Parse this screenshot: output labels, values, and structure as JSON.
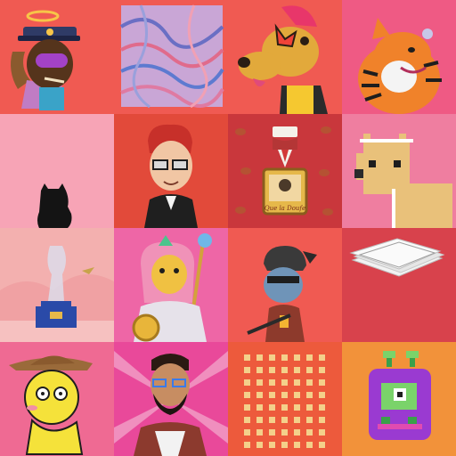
{
  "gallery": {
    "tiles": [
      {
        "id": "nft-1",
        "subject": "haloed-police-cat-avatar",
        "background": "#f05a52"
      },
      {
        "id": "nft-2",
        "subject": "abstract-swirl-art",
        "background": "#f05a52"
      },
      {
        "id": "nft-3",
        "subject": "dog-with-red-hair-avatar",
        "background": "#f05a52"
      },
      {
        "id": "nft-4",
        "subject": "tiger-cartoon-avatar",
        "background": "#ef5a84"
      },
      {
        "id": "nft-5",
        "subject": "cat-silhouette-art",
        "background": "#f7a4b6"
      },
      {
        "id": "nft-6",
        "subject": "red-haired-man-avatar",
        "background": "#e24a3a"
      },
      {
        "id": "nft-7",
        "subject": "medal-collectible",
        "background": "#c9373c",
        "medal_caption": "Que la Doufe"
      },
      {
        "id": "nft-8",
        "subject": "pixel-alpaca-avatar",
        "background": "#ef7ea0"
      },
      {
        "id": "nft-9",
        "subject": "crystal-statue-3d-art",
        "background": "#f0a1a3"
      },
      {
        "id": "nft-10",
        "subject": "pink-haired-fantasy-warrior",
        "background": "#ee66a6"
      },
      {
        "id": "nft-11",
        "subject": "samurai-dog-avatar",
        "background": "#f05a52"
      },
      {
        "id": "nft-12",
        "subject": "paper-stack-art",
        "background": "#d8424c"
      },
      {
        "id": "nft-13",
        "subject": "yellow-cowboy-creature",
        "background": "#ef6a93"
      },
      {
        "id": "nft-14",
        "subject": "bearded-man-avatar",
        "background": "#e9499a"
      },
      {
        "id": "nft-15",
        "subject": "dot-grid-generative-art",
        "background": "#ed5a3c"
      },
      {
        "id": "nft-16",
        "subject": "pixel-alien-creature",
        "background": "#f2923a"
      }
    ]
  },
  "colors": {
    "page_background": "#ee5a4f"
  }
}
